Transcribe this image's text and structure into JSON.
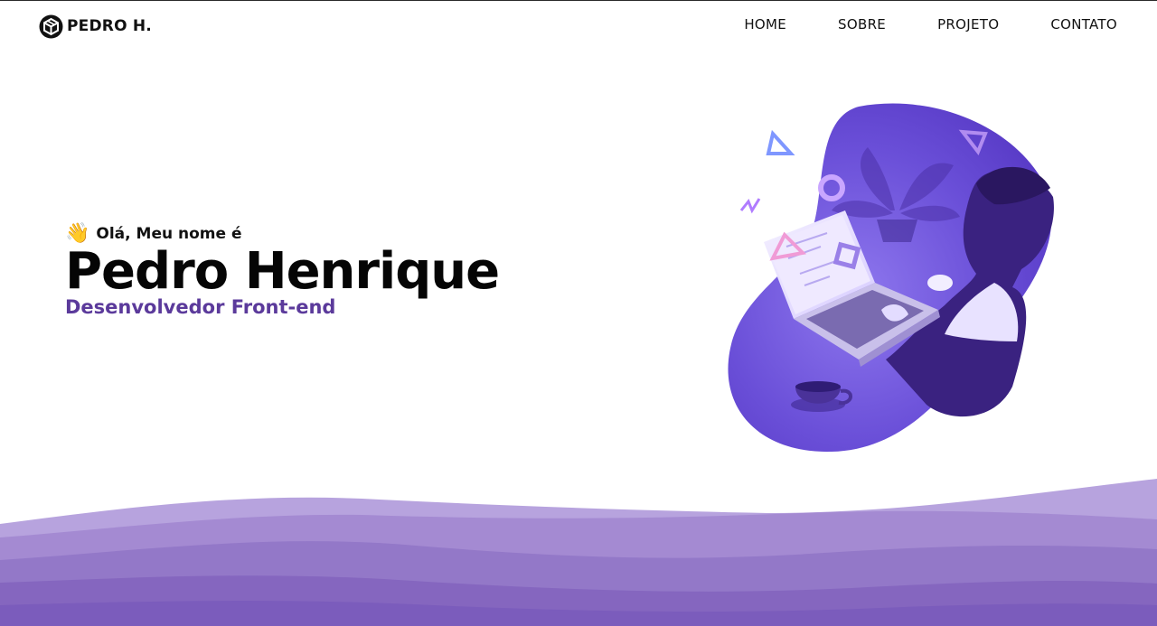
{
  "brand": {
    "name": "PEDRO H.",
    "icon": "box-logo-icon"
  },
  "nav": {
    "items": [
      {
        "label": "HOME"
      },
      {
        "label": "SOBRE"
      },
      {
        "label": "PROJETO"
      },
      {
        "label": "CONTATO"
      }
    ]
  },
  "hero": {
    "wave_emoji": "👋",
    "greeting": "Olá, Meu nome é",
    "name": "Pedro Henrique",
    "role": "Desenvolvedor Front-end"
  },
  "colors": {
    "accent": "#5b3a9b",
    "illustration_purple": "#6a4fd8",
    "wave_light": "#b7a3de",
    "wave_mid": "#9d82cf",
    "wave_dark": "#7b5cbc"
  }
}
